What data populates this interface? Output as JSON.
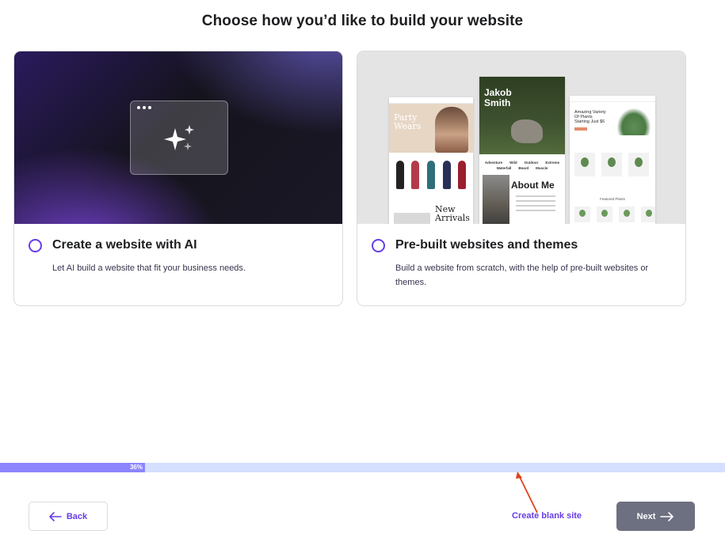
{
  "page": {
    "title": "Choose how you’d like to build your website"
  },
  "cards": {
    "ai": {
      "title": "Create a website with AI",
      "description": "Let AI build a website that fit your business needs.",
      "icon": "sparkle-icon"
    },
    "themes": {
      "title": "Pre-built websites and themes",
      "description": "Build a website from scratch, with the help of pre-built websites or themes.",
      "preview": {
        "party": "Party Wears",
        "new_arrivals": "New Arrivals",
        "jakob": "Jakob Smith",
        "tags": [
          "Adventure",
          "Wild",
          "Outdoor",
          "Extreme",
          "Waterfall",
          "Beard",
          "Muscle"
        ],
        "about": "About Me",
        "plants": "Amazing Variety Of Plants Starting Just $6",
        "featured": "Featured Plants"
      }
    }
  },
  "progress": {
    "label": "36%",
    "value": 0.2
  },
  "footer": {
    "back_label": "Back",
    "blank_label": "Create blank site",
    "next_label": "Next"
  },
  "colors": {
    "accent": "#673de6",
    "progress_fill": "#8c85ff",
    "progress_track": "#d5dfff",
    "next_bg": "#6d7081",
    "annotation": "#e0421a"
  }
}
